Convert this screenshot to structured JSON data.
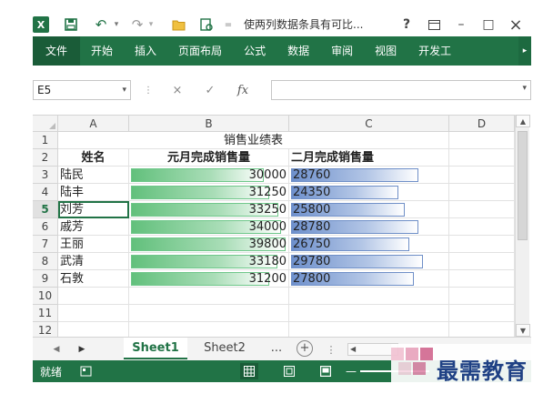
{
  "titlebar": {
    "app_logo": "X",
    "title": "使两列数据条具有可比...",
    "help": "?",
    "restore_icon": "ribbon-display-icon",
    "minimize": "–",
    "maximize": "□",
    "close": "×"
  },
  "ribbon": {
    "tabs": [
      {
        "label": "文件"
      },
      {
        "label": "开始"
      },
      {
        "label": "插入"
      },
      {
        "label": "页面布局"
      },
      {
        "label": "公式"
      },
      {
        "label": "数据"
      },
      {
        "label": "审阅"
      },
      {
        "label": "视图"
      },
      {
        "label": "开发工"
      }
    ]
  },
  "formula_bar": {
    "name_box": "E5",
    "cancel": "×",
    "enter": "✓",
    "fx": "fx",
    "formula": ""
  },
  "grid": {
    "columns": [
      "A",
      "B",
      "C",
      "D"
    ],
    "rows": [
      "1",
      "2",
      "3",
      "4",
      "5",
      "6",
      "7",
      "8",
      "9",
      "10",
      "11",
      "12"
    ],
    "title": "销售业绩表",
    "headers": {
      "name": "姓名",
      "jan": "元月完成销售量",
      "feb": "二月完成销售量"
    },
    "data_bar_scale_max": 35000,
    "records": [
      {
        "name": "陆民",
        "jan": 30000,
        "feb": 28760
      },
      {
        "name": "陆丰",
        "jan": 31250,
        "feb": 24350
      },
      {
        "name": "刘芳",
        "jan": 33250,
        "feb": 25800
      },
      {
        "name": "戚芳",
        "jan": 34000,
        "feb": 28780
      },
      {
        "name": "王丽",
        "jan": 39800,
        "feb": 26750
      },
      {
        "name": "武清",
        "jan": 33180,
        "feb": 29780
      },
      {
        "name": "石敦",
        "jan": 31200,
        "feb": 27800
      }
    ],
    "selected_row": "5",
    "colors": {
      "jan_bar": "#62c07c",
      "feb_bar": "#6e90cc"
    }
  },
  "sheets": {
    "tabs": [
      "Sheet1",
      "Sheet2"
    ],
    "active": "Sheet1",
    "more": "...",
    "add": "+"
  },
  "status": {
    "ready": "就绪"
  },
  "watermark": {
    "text": "最需教育"
  },
  "colors": {
    "accent": "#217346"
  }
}
